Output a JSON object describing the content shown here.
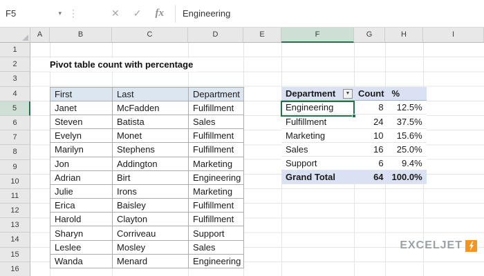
{
  "colors": {
    "accent_green": "#217346",
    "selected_header_bg": "#cee0d6",
    "data_table_header_bg": "#dce6f1",
    "pivot_header_bg": "#d9e1f2",
    "logo_gray": "#9aa0a6",
    "logo_orange": "#f7941e"
  },
  "formula_bar": {
    "name_box": "F5",
    "name_dropdown_icon": "▾",
    "dots_icon": "⋮",
    "cancel_icon": "✕",
    "enter_icon": "✓",
    "fx_label": "fx",
    "formula": "Engineering"
  },
  "grid": {
    "columns": [
      "A",
      "B",
      "C",
      "D",
      "E",
      "F",
      "G",
      "H",
      "I"
    ],
    "rows": [
      "1",
      "2",
      "3",
      "4",
      "5",
      "6",
      "7",
      "8",
      "9",
      "10",
      "11",
      "12",
      "13",
      "14",
      "15",
      "16"
    ],
    "selected_cell": "F5"
  },
  "title": "Pivot table count with percentage",
  "data_table": {
    "headers": [
      "First",
      "Last",
      "Department"
    ],
    "rows": [
      [
        "Janet",
        "McFadden",
        "Fulfillment"
      ],
      [
        "Steven",
        "Batista",
        "Sales"
      ],
      [
        "Evelyn",
        "Monet",
        "Fulfillment"
      ],
      [
        "Marilyn",
        "Stephens",
        "Fulfillment"
      ],
      [
        "Jon",
        "Addington",
        "Marketing"
      ],
      [
        "Adrian",
        "Birt",
        "Engineering"
      ],
      [
        "Julie",
        "Irons",
        "Marketing"
      ],
      [
        "Erica",
        "Baisley",
        "Fulfillment"
      ],
      [
        "Harold",
        "Clayton",
        "Fulfillment"
      ],
      [
        "Sharyn",
        "Corriveau",
        "Support"
      ],
      [
        "Leslee",
        "Mosley",
        "Sales"
      ],
      [
        "Wanda",
        "Menard",
        "Engineering"
      ]
    ]
  },
  "pivot_table": {
    "headers": [
      "Department",
      "Count",
      "%"
    ],
    "filter_icon": "▼",
    "rows": [
      [
        "Engineering",
        "8",
        "12.5%"
      ],
      [
        "Fulfillment",
        "24",
        "37.5%"
      ],
      [
        "Marketing",
        "10",
        "15.6%"
      ],
      [
        "Sales",
        "16",
        "25.0%"
      ],
      [
        "Support",
        "6",
        "9.4%"
      ]
    ],
    "grand_total": [
      "Grand Total",
      "64",
      "100.0%"
    ]
  },
  "logo": {
    "text": "EXCELJET"
  }
}
